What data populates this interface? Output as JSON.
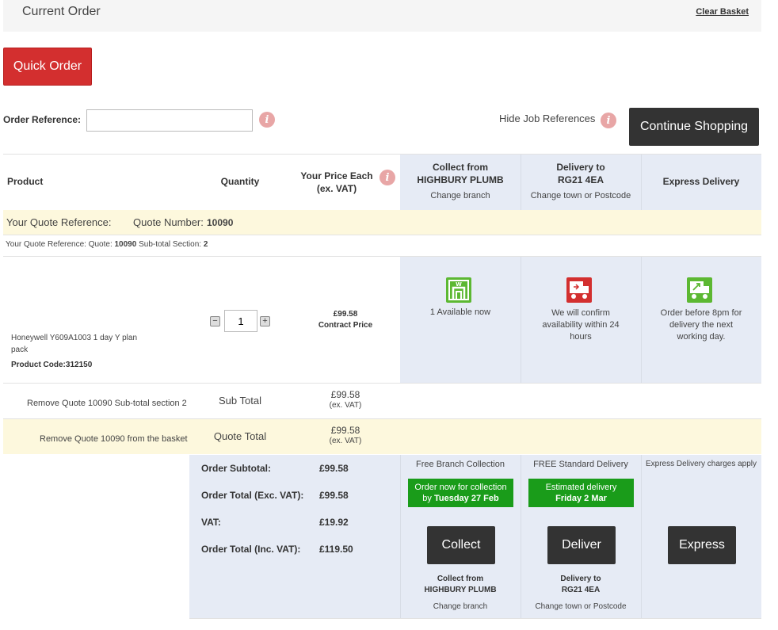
{
  "header": {
    "title": "Current Order",
    "clear_basket": "Clear Basket"
  },
  "quick_order": "Quick Order",
  "order_reference": {
    "label": "Order Reference:",
    "value": "",
    "placeholder": ""
  },
  "hide_job_references": "Hide Job References",
  "continue_shopping": "Continue Shopping",
  "columns": {
    "product": "Product",
    "quantity": "Quantity",
    "price_line1": "Your Price Each",
    "price_line2": "(ex. VAT)",
    "collect_line1": "Collect from",
    "collect_line2": "HIGHBURY PLUMB",
    "collect_link": "Change branch",
    "delivery_line1": "Delivery to",
    "delivery_line2": "RG21 4EA",
    "delivery_link": "Change town or Postcode",
    "express": "Express Delivery"
  },
  "quote": {
    "reference_label": "Your Quote Reference:",
    "number_label": "Quote Number:",
    "number": "10090",
    "section_prefix": "Your Quote Reference: Quote:",
    "section_mid": "Sub-total Section:",
    "section_number": "2"
  },
  "product": {
    "name": "Honeywell Y609A1003 1 day Y plan pack",
    "code_label": "Product Code:",
    "code": "312150",
    "quantity": "1",
    "price": "£99.58",
    "price_type": "Contract Price",
    "collect_status": "1 Available now",
    "delivery_status": "We will confirm availability within 24 hours",
    "express_status": "Order before 8pm for delivery the next working day."
  },
  "subtotal_row": {
    "remove": "Remove Quote 10090 Sub-total section 2",
    "label": "Sub Total",
    "value": "£99.58",
    "vat_note": "(ex. VAT)"
  },
  "quote_total_row": {
    "remove": "Remove Quote 10090 from the basket",
    "label": "Quote Total",
    "value": "£99.58",
    "vat_note": "(ex. VAT)"
  },
  "summary": {
    "subtotal_label": "Order Subtotal:",
    "subtotal": "£99.58",
    "total_exc_label": "Order Total (Exc. VAT):",
    "total_exc": "£99.58",
    "vat_label": "VAT:",
    "vat": "£19.92",
    "total_inc_label": "Order Total (Inc. VAT):",
    "total_inc": "£119.50"
  },
  "collect_option": {
    "heading": "Free Branch Collection",
    "badge_line1": "Order now for collection",
    "badge_line2_prefix": "by",
    "badge_date": "Tuesday 27 Feb",
    "button": "Collect",
    "footer_line1": "Collect from",
    "footer_line2": "HIGHBURY PLUMB",
    "footer_link": "Change branch"
  },
  "delivery_option": {
    "heading": "FREE Standard Delivery",
    "badge_prefix": "Estimated delivery",
    "badge_date": "Friday 2 Mar",
    "button": "Deliver",
    "footer_line1": "Delivery to",
    "footer_line2": "RG21 4EA",
    "footer_link": "Change town or Postcode"
  },
  "express_option": {
    "heading": "Express Delivery charges apply",
    "button": "Express"
  },
  "icons": {
    "info": "info-icon",
    "collect": "warehouse-icon",
    "delivery": "delivery-truck-icon",
    "express": "express-truck-icon",
    "minus": "minus-icon",
    "plus": "plus-icon"
  },
  "colors": {
    "accent_red": "#d32f2f",
    "dark_button": "#333333",
    "green": "#1a9c1a",
    "blue_panel": "#e6ebf5",
    "cream_row": "#fdf8dd"
  }
}
